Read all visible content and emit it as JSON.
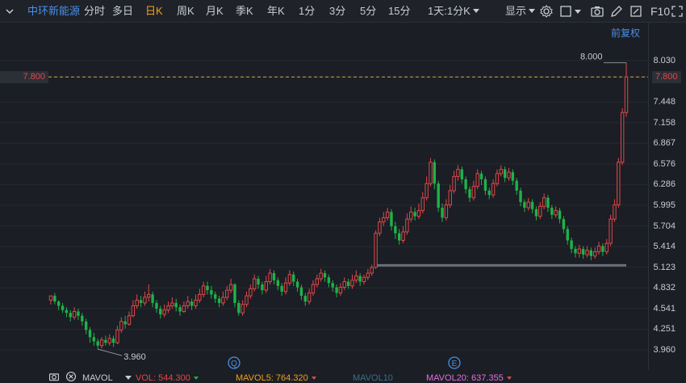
{
  "toolbar": {
    "stock_name": "中环新能源",
    "tabs": [
      "分时",
      "多日",
      "日K",
      "周K",
      "月K",
      "季K",
      "年K",
      "1分",
      "3分",
      "5分",
      "15分",
      "1天:1分K"
    ],
    "active_tab": "日K",
    "display_label": "显示",
    "f10_label": "F10"
  },
  "adjust_label": "前复权",
  "current_price_label": "7.800",
  "high_label": "8.000",
  "low_label": "3.960",
  "markers": [
    "Q",
    "E"
  ],
  "indicators": {
    "name": "MAVOL",
    "vol": "VOL: 544.300",
    "ma5": "MAVOL5: 764.320",
    "ma10": "MAVOL10",
    "ma20": "MAVOL20: 637.355"
  },
  "colors": {
    "up": "#e0484a",
    "down": "#1fb24a",
    "stock": "#4a8fe7",
    "active": "#f0a020",
    "ma5": "#f0a020",
    "ma10": "#3a6f8a",
    "ma20": "#e070e0"
  },
  "chart_data": {
    "type": "candlestick",
    "yticks": [
      "8.030",
      "7.800",
      "7.448",
      "7.158",
      "6.867",
      "6.576",
      "6.286",
      "5.995",
      "5.704",
      "5.414",
      "5.123",
      "4.832",
      "4.541",
      "4.251",
      "3.960"
    ],
    "ylim": [
      3.96,
      8.03
    ],
    "current_price": 7.8,
    "support_level": 5.15,
    "candles": [
      [
        4.66,
        4.72,
        4.72,
        4.6
      ],
      [
        4.72,
        4.64,
        4.76,
        4.6
      ],
      [
        4.64,
        4.58,
        4.66,
        4.52
      ],
      [
        4.58,
        4.52,
        4.62,
        4.48
      ],
      [
        4.52,
        4.48,
        4.56,
        4.42
      ],
      [
        4.48,
        4.42,
        4.52,
        4.36
      ],
      [
        4.42,
        4.5,
        4.56,
        4.38
      ],
      [
        4.5,
        4.44,
        4.54,
        4.38
      ],
      [
        4.44,
        4.36,
        4.48,
        4.3
      ],
      [
        4.36,
        4.24,
        4.4,
        4.18
      ],
      [
        4.24,
        4.14,
        4.28,
        4.06
      ],
      [
        4.14,
        4.08,
        4.2,
        4.02
      ],
      [
        4.08,
        4.02,
        4.12,
        3.97
      ],
      [
        4.02,
        4.1,
        4.14,
        3.98
      ],
      [
        4.1,
        4.06,
        4.16,
        4.02
      ],
      [
        4.06,
        4.12,
        4.18,
        4.02
      ],
      [
        4.12,
        4.06,
        4.16,
        4.0
      ],
      [
        4.06,
        4.24,
        4.3,
        4.04
      ],
      [
        4.24,
        4.36,
        4.42,
        4.2
      ],
      [
        4.36,
        4.32,
        4.44,
        4.26
      ],
      [
        4.32,
        4.44,
        4.5,
        4.3
      ],
      [
        4.44,
        4.58,
        4.66,
        4.42
      ],
      [
        4.58,
        4.66,
        4.74,
        4.54
      ],
      [
        4.66,
        4.62,
        4.72,
        4.56
      ],
      [
        4.62,
        4.7,
        4.78,
        4.58
      ],
      [
        4.7,
        4.74,
        4.88,
        4.64
      ],
      [
        4.74,
        4.62,
        4.78,
        4.56
      ],
      [
        4.62,
        4.54,
        4.66,
        4.48
      ],
      [
        4.54,
        4.46,
        4.58,
        4.4
      ],
      [
        4.46,
        4.52,
        4.6,
        4.42
      ],
      [
        4.52,
        4.58,
        4.64,
        4.48
      ],
      [
        4.58,
        4.62,
        4.7,
        4.54
      ],
      [
        4.62,
        4.56,
        4.68,
        4.5
      ],
      [
        4.56,
        4.5,
        4.6,
        4.44
      ],
      [
        4.5,
        4.58,
        4.64,
        4.48
      ],
      [
        4.58,
        4.64,
        4.72,
        4.54
      ],
      [
        4.64,
        4.58,
        4.68,
        4.52
      ],
      [
        4.58,
        4.66,
        4.74,
        4.54
      ],
      [
        4.66,
        4.74,
        4.82,
        4.62
      ],
      [
        4.74,
        4.86,
        4.92,
        4.7
      ],
      [
        4.86,
        4.8,
        4.92,
        4.74
      ],
      [
        4.8,
        4.74,
        4.86,
        4.68
      ],
      [
        4.74,
        4.68,
        4.78,
        4.62
      ],
      [
        4.68,
        4.62,
        4.72,
        4.56
      ],
      [
        4.62,
        4.7,
        4.78,
        4.58
      ],
      [
        4.7,
        4.8,
        4.86,
        4.66
      ],
      [
        4.8,
        4.88,
        4.96,
        4.76
      ],
      [
        4.88,
        4.62,
        4.9,
        4.56
      ],
      [
        4.62,
        4.48,
        4.66,
        4.44
      ],
      [
        4.48,
        4.6,
        4.66,
        4.44
      ],
      [
        4.6,
        4.72,
        4.78,
        4.56
      ],
      [
        4.72,
        4.82,
        4.88,
        4.68
      ],
      [
        4.82,
        4.96,
        5.02,
        4.78
      ],
      [
        4.96,
        4.88,
        5.0,
        4.82
      ],
      [
        4.88,
        4.8,
        4.92,
        4.74
      ],
      [
        4.8,
        4.92,
        5.0,
        4.76
      ],
      [
        4.92,
        5.04,
        5.1,
        4.88
      ],
      [
        5.04,
        4.94,
        5.08,
        4.88
      ],
      [
        4.94,
        4.86,
        4.98,
        4.8
      ],
      [
        4.86,
        4.78,
        4.9,
        4.72
      ],
      [
        4.78,
        4.9,
        4.98,
        4.74
      ],
      [
        4.9,
        5.02,
        5.08,
        4.86
      ],
      [
        5.02,
        4.92,
        5.06,
        4.86
      ],
      [
        4.92,
        4.84,
        4.96,
        4.78
      ],
      [
        4.84,
        4.72,
        4.88,
        4.66
      ],
      [
        4.72,
        4.64,
        4.76,
        4.58
      ],
      [
        4.64,
        4.76,
        4.82,
        4.6
      ],
      [
        4.76,
        4.88,
        4.94,
        4.72
      ],
      [
        4.88,
        4.96,
        5.02,
        4.84
      ],
      [
        4.96,
        5.04,
        5.1,
        4.92
      ],
      [
        5.04,
        4.98,
        5.08,
        4.92
      ],
      [
        4.98,
        4.9,
        5.02,
        4.84
      ],
      [
        4.9,
        4.84,
        4.94,
        4.78
      ],
      [
        4.84,
        4.76,
        4.88,
        4.7
      ],
      [
        4.76,
        4.84,
        4.9,
        4.72
      ],
      [
        4.84,
        4.92,
        4.98,
        4.8
      ],
      [
        4.92,
        4.86,
        4.96,
        4.82
      ],
      [
        4.86,
        4.94,
        5.02,
        4.82
      ],
      [
        4.94,
        5.0,
        5.08,
        4.9
      ],
      [
        5.0,
        4.92,
        5.04,
        4.86
      ],
      [
        4.92,
        4.98,
        5.02,
        4.88
      ],
      [
        4.98,
        5.04,
        5.1,
        4.94
      ],
      [
        5.04,
        5.12,
        5.16,
        5.0
      ],
      [
        5.12,
        5.6,
        5.64,
        5.1
      ],
      [
        5.6,
        5.76,
        5.82,
        5.56
      ],
      [
        5.76,
        5.82,
        5.9,
        5.7
      ],
      [
        5.82,
        5.9,
        5.96,
        5.78
      ],
      [
        5.9,
        5.7,
        5.94,
        5.64
      ],
      [
        5.7,
        5.6,
        5.76,
        5.52
      ],
      [
        5.6,
        5.5,
        5.66,
        5.44
      ],
      [
        5.5,
        5.62,
        5.7,
        5.46
      ],
      [
        5.62,
        5.8,
        5.88,
        5.58
      ],
      [
        5.8,
        5.9,
        5.98,
        5.76
      ],
      [
        5.9,
        5.84,
        5.96,
        5.78
      ],
      [
        5.84,
        5.92,
        6.02,
        5.8
      ],
      [
        5.92,
        6.1,
        6.18,
        5.88
      ],
      [
        6.1,
        6.3,
        6.4,
        6.06
      ],
      [
        6.3,
        6.6,
        6.66,
        6.26
      ],
      [
        6.6,
        6.3,
        6.64,
        6.22
      ],
      [
        6.3,
        5.96,
        6.34,
        5.9
      ],
      [
        5.96,
        5.82,
        6.02,
        5.76
      ],
      [
        5.82,
        6.0,
        6.08,
        5.78
      ],
      [
        6.0,
        6.2,
        6.28,
        5.96
      ],
      [
        6.2,
        6.4,
        6.48,
        6.16
      ],
      [
        6.4,
        6.5,
        6.56,
        6.34
      ],
      [
        6.5,
        6.36,
        6.54,
        6.3
      ],
      [
        6.36,
        6.22,
        6.4,
        6.16
      ],
      [
        6.22,
        6.1,
        6.26,
        6.04
      ],
      [
        6.1,
        6.26,
        6.34,
        6.06
      ],
      [
        6.26,
        6.44,
        6.5,
        6.22
      ],
      [
        6.44,
        6.36,
        6.48,
        6.28
      ],
      [
        6.36,
        6.2,
        6.4,
        6.14
      ],
      [
        6.2,
        6.14,
        6.24,
        6.08
      ],
      [
        6.14,
        6.3,
        6.36,
        6.1
      ],
      [
        6.3,
        6.44,
        6.5,
        6.26
      ],
      [
        6.44,
        6.5,
        6.56,
        6.4
      ],
      [
        6.5,
        6.38,
        6.54,
        6.32
      ],
      [
        6.38,
        6.46,
        6.52,
        6.34
      ],
      [
        6.46,
        6.34,
        6.5,
        6.28
      ],
      [
        6.34,
        6.2,
        6.38,
        6.14
      ],
      [
        6.2,
        6.04,
        6.24,
        5.98
      ],
      [
        6.04,
        5.96,
        6.08,
        5.9
      ],
      [
        5.96,
        6.04,
        6.1,
        5.92
      ],
      [
        6.04,
        5.94,
        6.08,
        5.88
      ],
      [
        5.94,
        5.84,
        5.98,
        5.78
      ],
      [
        5.84,
        5.98,
        6.04,
        5.8
      ],
      [
        5.98,
        6.1,
        6.16,
        5.94
      ],
      [
        6.1,
        5.96,
        6.14,
        5.9
      ],
      [
        5.96,
        5.86,
        6.0,
        5.8
      ],
      [
        5.86,
        5.92,
        5.98,
        5.82
      ],
      [
        5.92,
        5.8,
        5.96,
        5.74
      ],
      [
        5.8,
        5.66,
        5.84,
        5.6
      ],
      [
        5.66,
        5.5,
        5.7,
        5.44
      ],
      [
        5.5,
        5.38,
        5.54,
        5.32
      ],
      [
        5.38,
        5.32,
        5.42,
        5.26
      ],
      [
        5.32,
        5.38,
        5.44,
        5.26
      ],
      [
        5.38,
        5.3,
        5.42,
        5.24
      ],
      [
        5.3,
        5.36,
        5.42,
        5.26
      ],
      [
        5.36,
        5.28,
        5.4,
        5.22
      ],
      [
        5.28,
        5.34,
        5.4,
        5.24
      ],
      [
        5.34,
        5.42,
        5.48,
        5.3
      ],
      [
        5.42,
        5.34,
        5.46,
        5.28
      ],
      [
        5.34,
        5.46,
        5.52,
        5.3
      ],
      [
        5.46,
        5.8,
        5.86,
        5.42
      ],
      [
        5.8,
        6.0,
        6.08,
        5.76
      ],
      [
        6.0,
        6.6,
        6.66,
        5.96
      ],
      [
        6.6,
        7.3,
        7.36,
        6.56
      ],
      [
        7.3,
        7.8,
        8.0,
        7.24
      ]
    ]
  }
}
